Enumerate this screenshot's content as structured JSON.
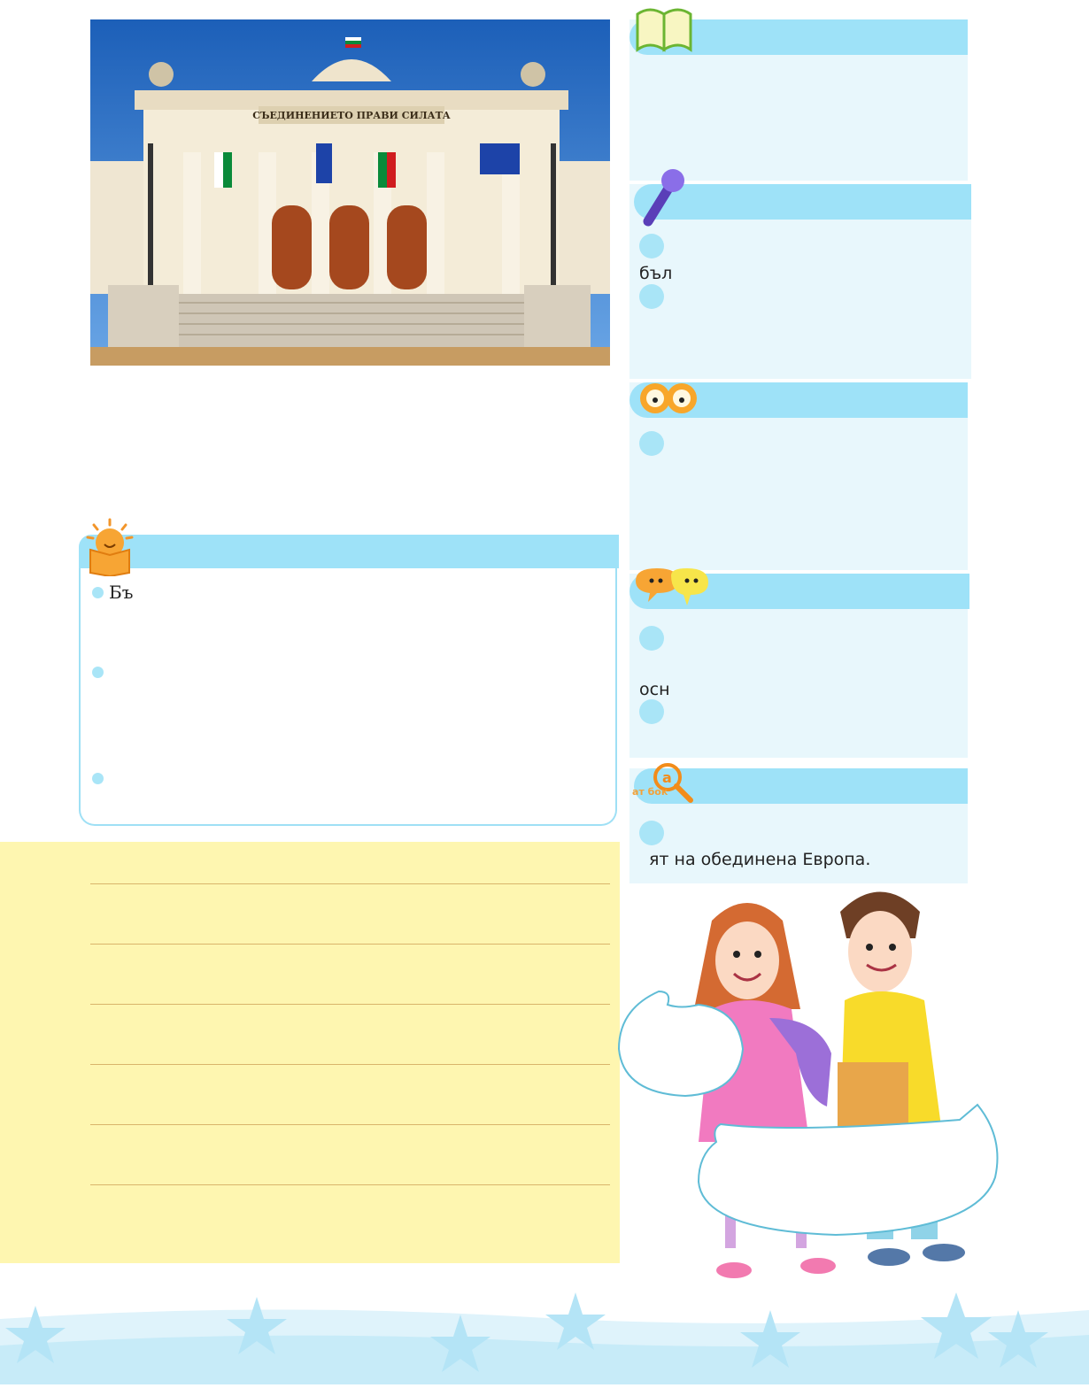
{
  "photo": {
    "inscription": "СЪЕДИНЕНИЕТО ПРАВИ СИЛАТА"
  },
  "reading": {
    "first_item": "Бъ"
  },
  "right_column": {
    "interview_fragment": "бъл",
    "discussion_fragment": "осн",
    "vocabulary_fragment": "ят на обединена Европа."
  },
  "colors": {
    "bar": "#9ee2f8",
    "panel": "#e8f7fc",
    "notes": "#fef6b0"
  },
  "icons": [
    "book-icon",
    "microphone-icon",
    "binoculars-icon",
    "speech-bubbles-icon",
    "magnifier-letters-icon",
    "sun-reading-icon"
  ]
}
